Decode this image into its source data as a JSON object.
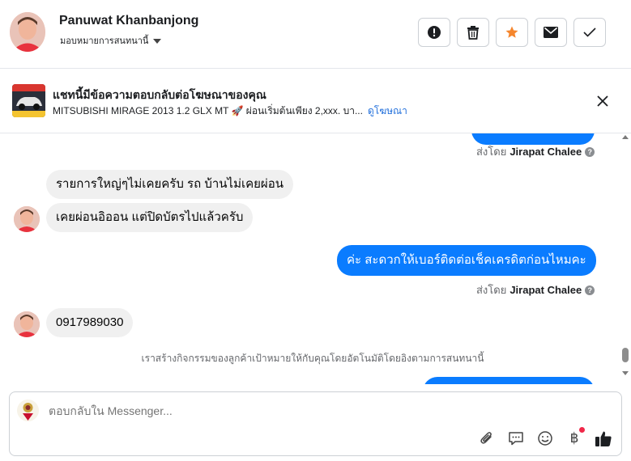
{
  "header": {
    "user_name": "Panuwat Khanbanjong",
    "assign_label": "มอบหมายการสนทนานี้",
    "actions": [
      {
        "icon": "alert-icon",
        "name": "spam-button"
      },
      {
        "icon": "trash-icon",
        "name": "delete-button"
      },
      {
        "icon": "star-icon",
        "name": "star-button"
      },
      {
        "icon": "envelope-icon",
        "name": "mark-unread-button"
      },
      {
        "icon": "check-icon",
        "name": "mark-done-button"
      }
    ]
  },
  "ad": {
    "title": "แชทนี้มีข้อความตอบกลับต่อโฆษณาของคุณ",
    "subtitle": "MITSUBISHI MIRAGE 2013 1.2 GLX MT 🚀 ผ่อนเริ่มต้นเพียง 2,xxx. บา...",
    "link": "ดูโฆษณา"
  },
  "messages": {
    "sent_by_prefix": "ส่งโดย",
    "sender_name": "Jirapat Chalee",
    "in_1": "รายการใหญ่ๆไม่เคยครับ รถ บ้านไม่เคยผ่อน",
    "in_2": "เคยผ่อนอิออน แต่ปิดบัตรไปแล้วครับ",
    "out_1": "ค่ะ สะดวกให้เบอร์ติดต่อเช็คเครดิตก่อนไหมคะ",
    "in_3": "0917989030",
    "system": "เราสร้างกิจกรรมของลูกค้าเป้าหมายให้กับคุณโดยอัตโนมัติโดยอิงตามการสนทนานี้"
  },
  "composer": {
    "placeholder": "ตอบกลับใน Messenger..."
  },
  "colors": {
    "accent": "#0a7cff",
    "star": "#f5862d",
    "link": "#216fdb"
  }
}
